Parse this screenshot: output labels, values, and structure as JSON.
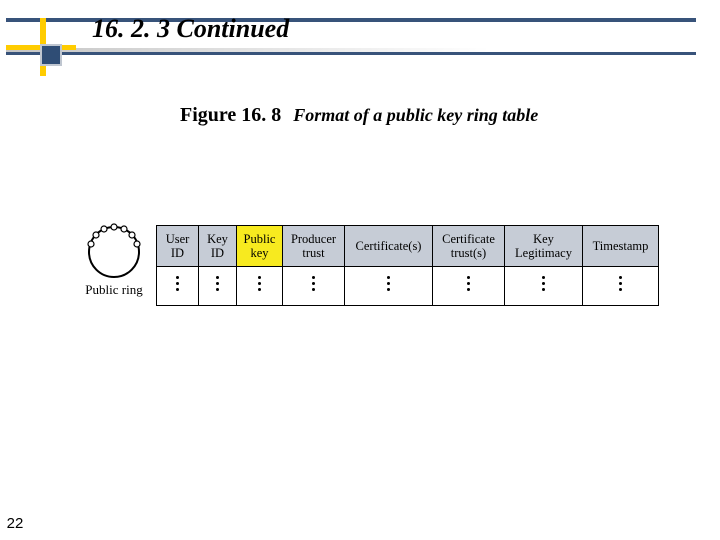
{
  "header": {
    "section_title": "16. 2. 3  Continued"
  },
  "figure": {
    "label": "Figure 16. 8",
    "description": "Format of a public key ring table"
  },
  "ring": {
    "label": "Public ring"
  },
  "table": {
    "headers": {
      "user_id": "User\nID",
      "key_id": "Key\nID",
      "public_key": "Public\nkey",
      "producer_trust": "Producer\ntrust",
      "certificates": "Certificate(s)",
      "cert_trust": "Certificate\ntrust(s)",
      "key_legitimacy": "Key\nLegitimacy",
      "timestamp": "Timestamp"
    }
  },
  "page": {
    "number": "22"
  }
}
